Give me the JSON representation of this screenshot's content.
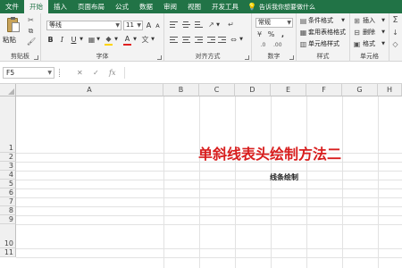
{
  "tabs": [
    "文件",
    "开始",
    "插入",
    "页面布局",
    "公式",
    "数据",
    "审阅",
    "视图",
    "开发工具"
  ],
  "active_tab": "开始",
  "tell_me": "告诉我你想要做什么",
  "ribbon": {
    "clipboard": {
      "paste": "粘贴",
      "label": "剪贴板"
    },
    "font": {
      "name": "等线",
      "size": "11",
      "bold": "B",
      "italic": "I",
      "underline": "U",
      "grow": "A",
      "shrink": "A",
      "font_color_glyph": "A",
      "label": "字体"
    },
    "alignment": {
      "label": "对齐方式"
    },
    "number": {
      "format": "常规",
      "currency": "%",
      "comma": ",",
      "label": "数字"
    },
    "styles": {
      "conditional": "条件格式",
      "table": "套用表格格式",
      "cell": "单元格样式",
      "label": "样式"
    },
    "cells": {
      "insert": "插入",
      "delete": "删除",
      "format": "格式",
      "label": "单元格"
    }
  },
  "name_box": "F5",
  "formula_icons": {
    "cancel": "✕",
    "enter": "✓",
    "fx": "fx"
  },
  "columns": [
    "A",
    "B",
    "C",
    "D",
    "E",
    "F",
    "G",
    "H"
  ],
  "rows": [
    "1",
    "2",
    "3",
    "4",
    "5",
    "6",
    "7",
    "8",
    "9",
    "10",
    "11"
  ],
  "cells": {
    "title": "单斜线表头绘制方法二",
    "subtitle": "线条绘制"
  },
  "colors": {
    "brand": "#217346",
    "title": "#d81e1e",
    "highlight": "#ffd400",
    "font_color": "#e02020"
  }
}
